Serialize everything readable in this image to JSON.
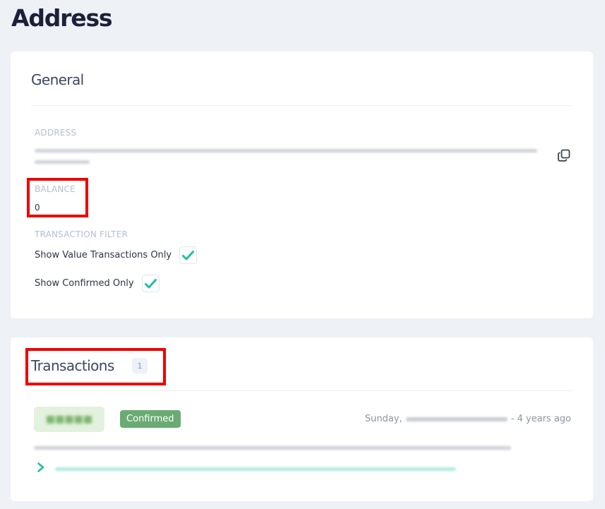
{
  "page": {
    "title": "Address"
  },
  "general": {
    "heading": "General",
    "address_label": "ADDRESS",
    "balance_label": "BALANCE",
    "balance_value": "0",
    "filter_label": "TRANSACTION FILTER",
    "filters": [
      {
        "label": "Show Value Transactions Only",
        "checked": true
      },
      {
        "label": "Show Confirmed Only",
        "checked": true
      }
    ]
  },
  "transactions": {
    "heading": "Transactions",
    "count": "1",
    "items": [
      {
        "status": "Confirmed",
        "day": "Sunday,",
        "relative_time": "- 4 years ago"
      }
    ]
  },
  "colors": {
    "accent": "#1fbfa7",
    "confirmed": "#6aab74",
    "highlight": "#ef0000"
  },
  "icons": [
    "copy-icon",
    "check-icon",
    "chevron-right-icon"
  ]
}
